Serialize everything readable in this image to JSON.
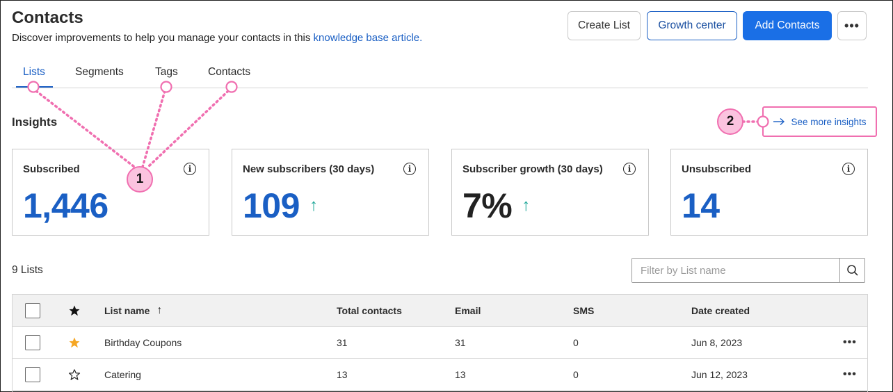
{
  "header": {
    "title": "Contacts",
    "subtitle_text": "Discover improvements to help you manage your contacts in this",
    "subtitle_link": "knowledge base article."
  },
  "actions": {
    "create_list": "Create List",
    "growth_center": "Growth center",
    "add_contacts": "Add Contacts",
    "more": "•••"
  },
  "tabs": [
    {
      "label": "Lists",
      "active": true
    },
    {
      "label": "Segments",
      "active": false
    },
    {
      "label": "Tags",
      "active": false
    },
    {
      "label": "Contacts",
      "active": false
    }
  ],
  "insights": {
    "heading": "Insights",
    "see_more": "See more insights",
    "cards": [
      {
        "title": "Subscribed",
        "value": "1,446",
        "trend": ""
      },
      {
        "title": "New subscribers (30 days)",
        "value": "109",
        "trend": "↑"
      },
      {
        "title": "Subscriber growth (30 days)",
        "value": "7%",
        "trend": "↑"
      },
      {
        "title": "Unsubscribed",
        "value": "14",
        "trend": ""
      }
    ],
    "info_glyph": "i"
  },
  "lists": {
    "count_label": "9 Lists",
    "filter_placeholder": "Filter by List name",
    "columns": {
      "name": "List name",
      "sort_arrow": "↑",
      "total": "Total contacts",
      "email": "Email",
      "sms": "SMS",
      "date": "Date created"
    },
    "rows": [
      {
        "name": "Birthday Coupons",
        "favorite": true,
        "total": "31",
        "email": "31",
        "sms": "0",
        "date": "Jun 8, 2023"
      },
      {
        "name": "Catering",
        "favorite": false,
        "total": "13",
        "email": "13",
        "sms": "0",
        "date": "Jun 12, 2023"
      }
    ],
    "row_menu": "•••"
  },
  "annotations": {
    "one": "1",
    "two": "2"
  },
  "colors": {
    "brand_blue": "#1a6fe6",
    "link_blue": "#1a5fc4",
    "trend_teal": "#22a89a",
    "star_orange": "#f5a623",
    "annotation_pink": "#f06fb0"
  }
}
